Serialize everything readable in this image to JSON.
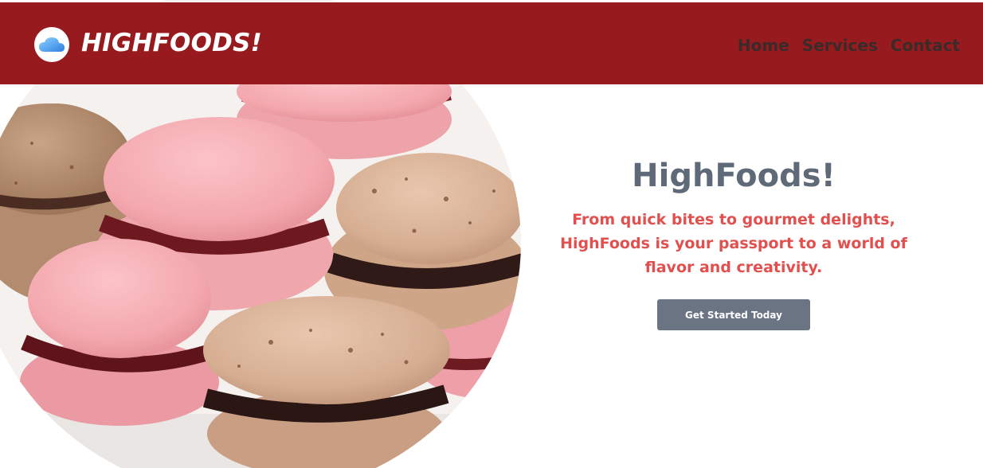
{
  "header": {
    "brand": "HIGHFOODS!",
    "logo_icon": "cloud-icon",
    "nav": [
      {
        "label": "Home"
      },
      {
        "label": "Services"
      },
      {
        "label": "Contact"
      }
    ]
  },
  "hero": {
    "image": "macarons-photo",
    "title": "HighFoods!",
    "subtitle": "From quick bites to gourmet delights, HighFoods is your passport to a world of flavor and creativity.",
    "cta_label": "Get Started Today"
  },
  "colors": {
    "header_bg": "#971b1e",
    "title": "#5e6a78",
    "subtitle": "#e1504e",
    "cta_bg": "#6b7482"
  }
}
